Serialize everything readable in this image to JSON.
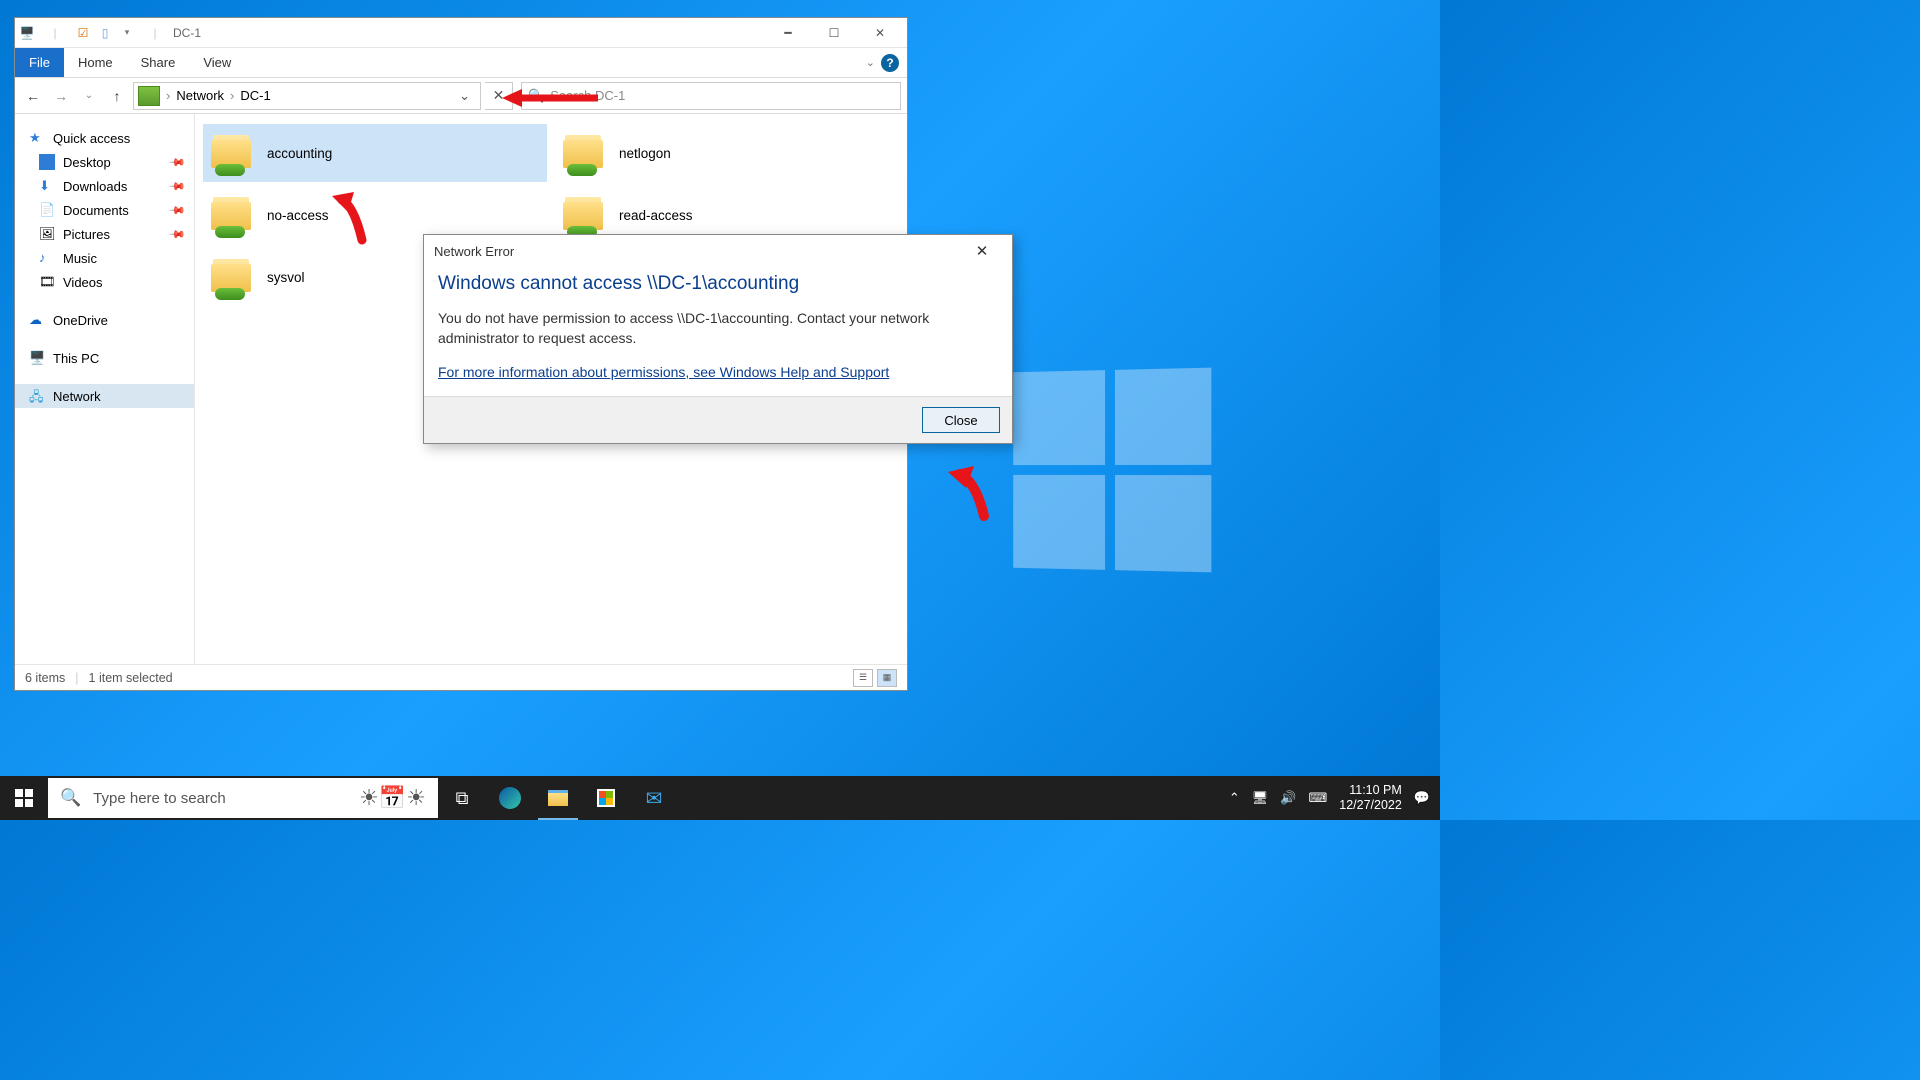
{
  "window": {
    "title": "DC-1",
    "tabs": {
      "file": "File",
      "home": "Home",
      "share": "Share",
      "view": "View"
    },
    "breadcrumb": {
      "root": "Network",
      "current": "DC-1"
    },
    "search_placeholder": "Search DC-1"
  },
  "sidebar": {
    "quick_access": "Quick access",
    "items": [
      {
        "label": "Desktop",
        "pinned": true
      },
      {
        "label": "Downloads",
        "pinned": true
      },
      {
        "label": "Documents",
        "pinned": true
      },
      {
        "label": "Pictures",
        "pinned": true
      },
      {
        "label": "Music",
        "pinned": false
      },
      {
        "label": "Videos",
        "pinned": false
      }
    ],
    "onedrive": "OneDrive",
    "thispc": "This PC",
    "network": "Network"
  },
  "folders": [
    {
      "name": "accounting",
      "selected": true
    },
    {
      "name": "netlogon",
      "selected": false
    },
    {
      "name": "no-access",
      "selected": false
    },
    {
      "name": "read-access",
      "selected": false
    },
    {
      "name": "sysvol",
      "selected": false
    }
  ],
  "status": {
    "items": "6 items",
    "selection": "1 item selected"
  },
  "dialog": {
    "title": "Network Error",
    "heading": "Windows cannot access \\\\DC-1\\accounting",
    "message": "You do not have permission to access \\\\DC-1\\accounting. Contact your network administrator to request access.",
    "link": "For more information about permissions, see Windows Help and Support",
    "close": "Close"
  },
  "taskbar": {
    "search_placeholder": "Type here to search",
    "time": "11:10 PM",
    "date": "12/27/2022"
  }
}
